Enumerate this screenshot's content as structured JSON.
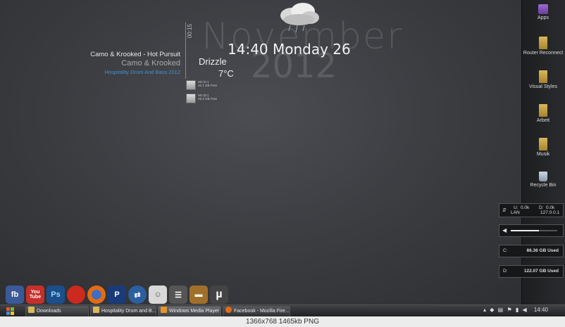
{
  "date": {
    "month": "November",
    "year": "2012",
    "clock": "14:40 Monday 26"
  },
  "weather": {
    "condition": "Drizzle",
    "temp": "7°C"
  },
  "media": {
    "timer": "00:15",
    "track": "Camo & Krooked - Hot Pursuit",
    "artist": "Camo & Krooked",
    "album": "Hospitality Drum And Bass 2012"
  },
  "drives": [
    {
      "name": "HD (C:)",
      "free": "42.1 GB Free"
    },
    {
      "name": "HD (D:)",
      "free": "29.3 GB Free"
    }
  ],
  "desktop_icons": [
    {
      "label": "Apps",
      "icon": "apps-icon"
    },
    {
      "label": "Router Reconnect",
      "icon": "folder-icon"
    },
    {
      "label": "Visual Styles",
      "icon": "folder-icon"
    },
    {
      "label": "Arbeit",
      "icon": "folder-icon"
    },
    {
      "label": "Musik",
      "icon": "folder-icon"
    },
    {
      "label": "Recycle Bin",
      "icon": "recycle-bin-icon"
    }
  ],
  "gadgets": {
    "network": {
      "up_label": "U:",
      "up": "0.0k",
      "down_label": "D:",
      "down": "0.0k",
      "lan": "LAN",
      "ip": "127.0.0.1"
    },
    "volume": {
      "level": 0.6
    },
    "drive_c": {
      "label": "C:",
      "value": "86.36 GB Used"
    },
    "drive_d": {
      "label": "D:",
      "value": "122.07 GB Used"
    }
  },
  "dock": [
    {
      "label": "fb",
      "icon": "facebook-icon",
      "color": "#3b5998"
    },
    {
      "label": "You Tube",
      "icon": "youtube-icon",
      "color": "#c4302b"
    },
    {
      "label": "Ps",
      "icon": "photoshop-icon",
      "color": "#1c4f8a"
    },
    {
      "label": "",
      "icon": "angry-birds-icon",
      "color": "#cc2a1e"
    },
    {
      "label": "",
      "icon": "firefox-icon",
      "color": "#e46b16"
    },
    {
      "label": "",
      "icon": "playstation-icon",
      "color": "#1a3b7a"
    },
    {
      "label": "",
      "icon": "sync-icon",
      "color": "#2c5fa0"
    },
    {
      "label": "",
      "icon": "messenger-icon",
      "color": "#d8d8d8"
    },
    {
      "label": "",
      "icon": "notes-icon",
      "color": "#555"
    },
    {
      "label": "",
      "icon": "briefcase-icon",
      "color": "#a0702a"
    },
    {
      "label": "µ",
      "icon": "utorrent-icon",
      "color": "#444"
    }
  ],
  "taskbar": {
    "buttons": [
      {
        "label": "Downloads",
        "icon": "folder-icon",
        "color": "#d9b85a"
      },
      {
        "label": "Hospitality Drum and B...",
        "icon": "folder-icon",
        "color": "#d9b85a"
      },
      {
        "label": "Windows Media Player",
        "icon": "media-player-icon",
        "color": "#e69528"
      },
      {
        "label": "Facebook - Mozilla Fire...",
        "icon": "firefox-icon",
        "color": "#e46b16"
      }
    ],
    "clock": "14:40"
  },
  "footer": {
    "caption": "1366x768  1465kb  PNG"
  }
}
